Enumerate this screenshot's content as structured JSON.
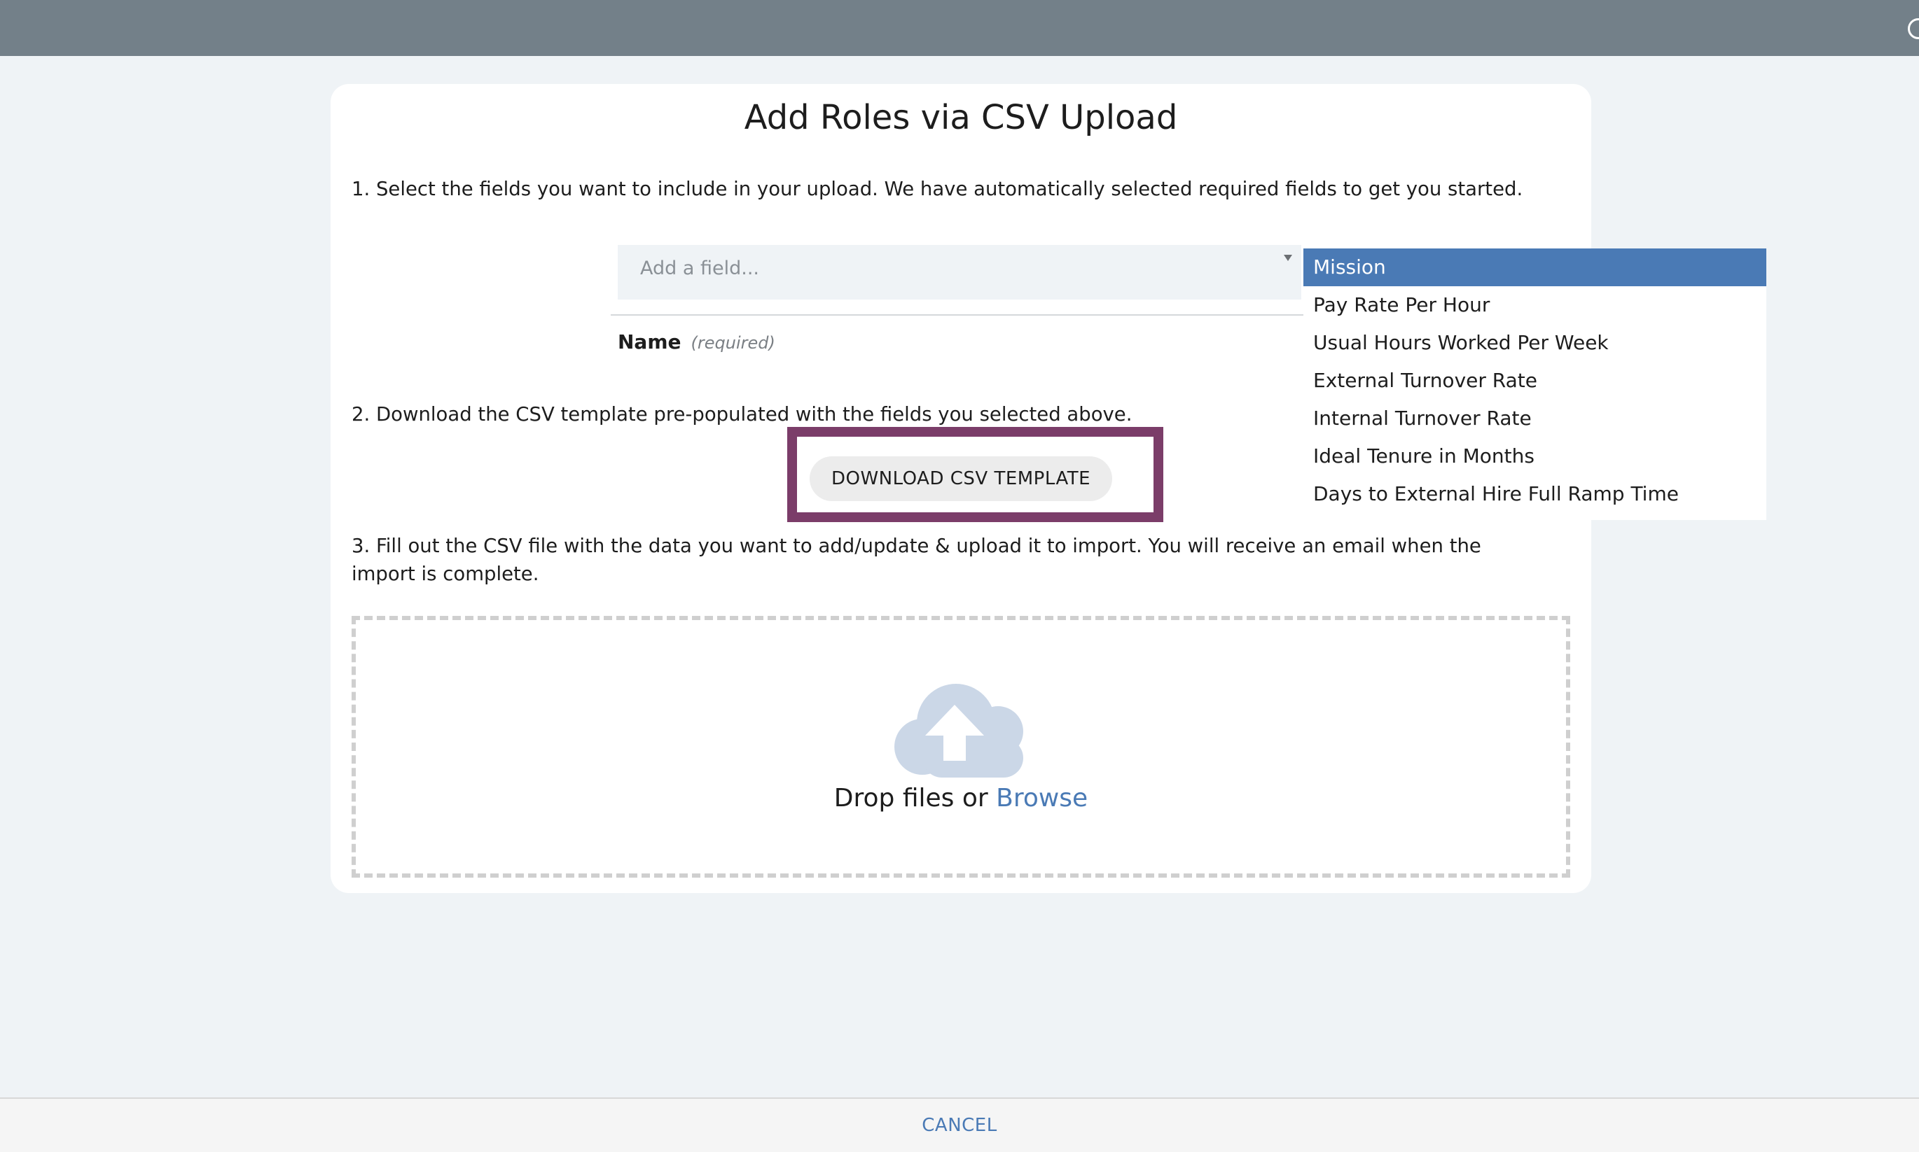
{
  "modal": {
    "title": "Add Roles via CSV Upload",
    "step1_text": "1. Select the fields you want to include in your upload. We have automatically selected required fields to get you started.",
    "field_select": {
      "placeholder": "Add a field..."
    },
    "selected_field": {
      "label": "Name",
      "note": "(required)"
    },
    "step2_text": "2. Download the CSV template pre-populated with the fields you selected above.",
    "download_button": "DOWNLOAD CSV TEMPLATE",
    "step3_text": "3. Fill out the CSV file with the data you want to add/update & upload it to import. You will receive an email when the import is complete.",
    "dropzone": {
      "text": "Drop files or",
      "browse": "Browse",
      "icon": "cloud-upload-icon"
    }
  },
  "dropdown": {
    "items": [
      {
        "label": "Mission",
        "selected": true
      },
      {
        "label": "Pay Rate Per Hour"
      },
      {
        "label": "Usual Hours Worked Per Week"
      },
      {
        "label": "External Turnover Rate"
      },
      {
        "label": "Internal Turnover Rate"
      },
      {
        "label": "Ideal Tenure in Months"
      },
      {
        "label": "Days to External Hire Full Ramp Time"
      }
    ]
  },
  "footer": {
    "cancel": "CANCEL"
  },
  "colors": {
    "accent": "#4a7ab5",
    "highlight": "#7b3d69",
    "topbar": "#738089",
    "background": "#eff3f6",
    "cloud": "#cbd7e7"
  }
}
